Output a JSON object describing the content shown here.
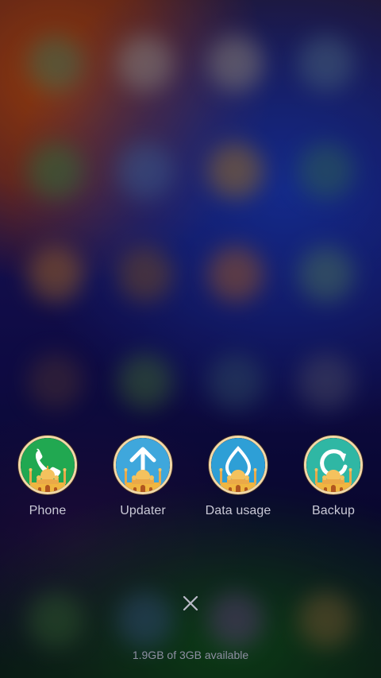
{
  "apps": [
    {
      "label": "Phone",
      "icon": "phone-icon",
      "color": "#21a851"
    },
    {
      "label": "Updater",
      "icon": "updater-arrow-icon",
      "color": "#3fa7dc"
    },
    {
      "label": "Data usage",
      "icon": "data-usage-drop-icon",
      "color": "#2e9fd6"
    },
    {
      "label": "Backup",
      "icon": "backup-refresh-icon",
      "color": "#2fb7a4"
    }
  ],
  "dialog": {
    "close_icon": "close-icon"
  },
  "storage": {
    "text": "1.9GB of 3GB available"
  },
  "colors": {
    "label_text": "#c9c9d6",
    "storage_text": "#8e8fa2",
    "icon_ring": "#f3d9a6"
  }
}
